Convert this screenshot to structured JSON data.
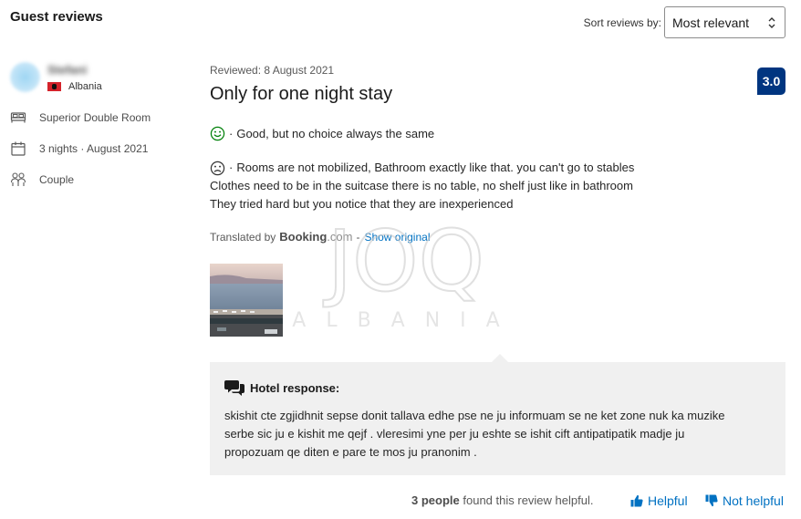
{
  "header": {
    "title": "Guest reviews",
    "sort_label": "Sort reviews by:",
    "sort_value": "Most relevant"
  },
  "reviewer": {
    "name": "Stefani",
    "country": "Albania",
    "room": "Superior Double Room",
    "stay": "3 nights · August 2021",
    "traveler_type": "Couple"
  },
  "review": {
    "date": "Reviewed: 8 August 2021",
    "title": "Only for one night stay",
    "score": "3.0",
    "positive": "Good, but no choice always the same",
    "negative_lines": [
      "Rooms are not mobilized, Bathroom exactly like that. you can't go to stables",
      "Clothes need to be in the suitcase there is no table, no shelf just like in bathroom",
      "They tried hard but you notice that they are inexperienced"
    ],
    "separator": "·",
    "translated_by": "Translated by",
    "translator_brand": "Booking",
    "translator_brand_suffix": ".com",
    "dash": "-",
    "show_original": "Show original"
  },
  "watermark": {
    "logo": "JOQ",
    "text": "ALBANIA"
  },
  "hotel_response": {
    "heading": "Hotel response:",
    "lines": [
      "skishit cte zgjidhnit sepse donit tallava edhe pse ne ju informuam se ne ket zone nuk ka muzike",
      "serbe sic ju e kishit me qejf . vleresimi yne per ju eshte se ishit cift antipatipatik madje ju",
      "propozuam qe diten e pare te mos ju pranonim ."
    ]
  },
  "footer": {
    "helpful_count": "3 people",
    "helpful_suffix": "found this review helpful.",
    "helpful_button": "Helpful",
    "not_helpful_button": "Not helpful"
  },
  "colors": {
    "score_bg": "#003580",
    "link": "#0071c2",
    "positive_face": "#008009",
    "response_bg": "#f0f0f0"
  },
  "icons": {
    "sort": "chevron-up-down-icon",
    "room": "bed-icon",
    "stay": "calendar-icon",
    "traveler": "people-icon",
    "positive": "smiley-happy-icon",
    "negative": "smiley-sad-icon",
    "response": "speech-bubbles-icon",
    "helpful": "thumbs-up-icon",
    "not_helpful": "thumbs-down-icon"
  }
}
